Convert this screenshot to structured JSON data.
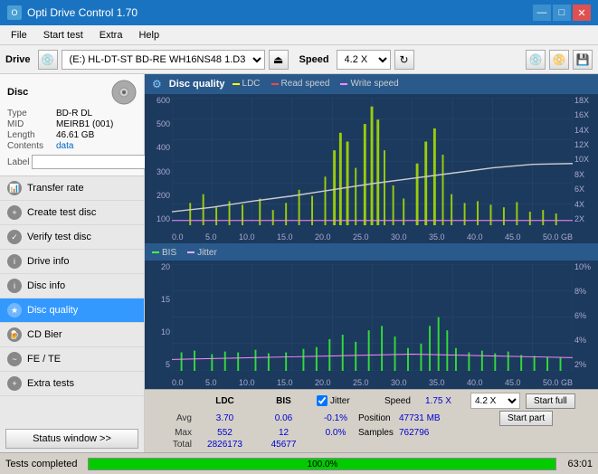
{
  "app": {
    "title": "Opti Drive Control 1.70",
    "icon": "O"
  },
  "titlebar": {
    "minimize": "—",
    "maximize": "□",
    "close": "✕"
  },
  "menu": {
    "items": [
      "File",
      "Start test",
      "Extra",
      "Help"
    ]
  },
  "toolbar": {
    "drive_label": "Drive",
    "drive_value": "(E:)  HL-DT-ST BD-RE  WH16NS48 1.D3",
    "speed_label": "Speed",
    "speed_value": "4.2 X"
  },
  "disc": {
    "section_title": "Disc",
    "type_label": "Type",
    "type_value": "BD-R DL",
    "mid_label": "MID",
    "mid_value": "MEIRB1 (001)",
    "length_label": "Length",
    "length_value": "46.61 GB",
    "contents_label": "Contents",
    "contents_value": "data",
    "label_label": "Label",
    "label_value": ""
  },
  "nav": {
    "items": [
      {
        "id": "transfer-rate",
        "label": "Transfer rate",
        "active": false
      },
      {
        "id": "create-test-disc",
        "label": "Create test disc",
        "active": false
      },
      {
        "id": "verify-test-disc",
        "label": "Verify test disc",
        "active": false
      },
      {
        "id": "drive-info",
        "label": "Drive info",
        "active": false
      },
      {
        "id": "disc-info",
        "label": "Disc info",
        "active": false
      },
      {
        "id": "disc-quality",
        "label": "Disc quality",
        "active": true
      },
      {
        "id": "cd-bier",
        "label": "CD Bier",
        "active": false
      },
      {
        "id": "fe-te",
        "label": "FE / TE",
        "active": false
      },
      {
        "id": "extra-tests",
        "label": "Extra tests",
        "active": false
      }
    ],
    "status_btn": "Status window >>"
  },
  "chart": {
    "title": "Disc quality",
    "top_legend": {
      "ldc": "LDC",
      "read": "Read speed",
      "write": "Write speed"
    },
    "top_y_left": [
      "600",
      "500",
      "400",
      "300",
      "200",
      "100"
    ],
    "top_y_right": [
      "18X",
      "16X",
      "14X",
      "12X",
      "10X",
      "8X",
      "6X",
      "4X",
      "2X"
    ],
    "x_labels": [
      "0.0",
      "5.0",
      "10.0",
      "15.0",
      "20.0",
      "25.0",
      "30.0",
      "35.0",
      "40.0",
      "45.0",
      "50.0 GB"
    ],
    "bot_legend": {
      "bis": "BIS",
      "jitter": "Jitter"
    },
    "bot_y_left": [
      "20",
      "15",
      "10",
      "5"
    ],
    "bot_y_right": [
      "10%",
      "8%",
      "6%",
      "4%",
      "2%"
    ]
  },
  "stats": {
    "col_ldc": "LDC",
    "col_bis": "BIS",
    "col_jitter": "Jitter",
    "col_speed": "Speed",
    "avg_label": "Avg",
    "avg_ldc": "3.70",
    "avg_bis": "0.06",
    "avg_jitter": "-0.1%",
    "max_label": "Max",
    "max_ldc": "552",
    "max_bis": "12",
    "max_jitter": "0.0%",
    "total_label": "Total",
    "total_ldc": "2826173",
    "total_bis": "45677",
    "speed_val": "1.75 X",
    "speed_select": "4.2 X",
    "position_label": "Position",
    "position_val": "47731 MB",
    "samples_label": "Samples",
    "samples_val": "762796",
    "start_full": "Start full",
    "start_part": "Start part",
    "progress_pct": 100,
    "progress_text": "100.0%",
    "time_label": "63:01",
    "status_text": "Tests completed"
  }
}
